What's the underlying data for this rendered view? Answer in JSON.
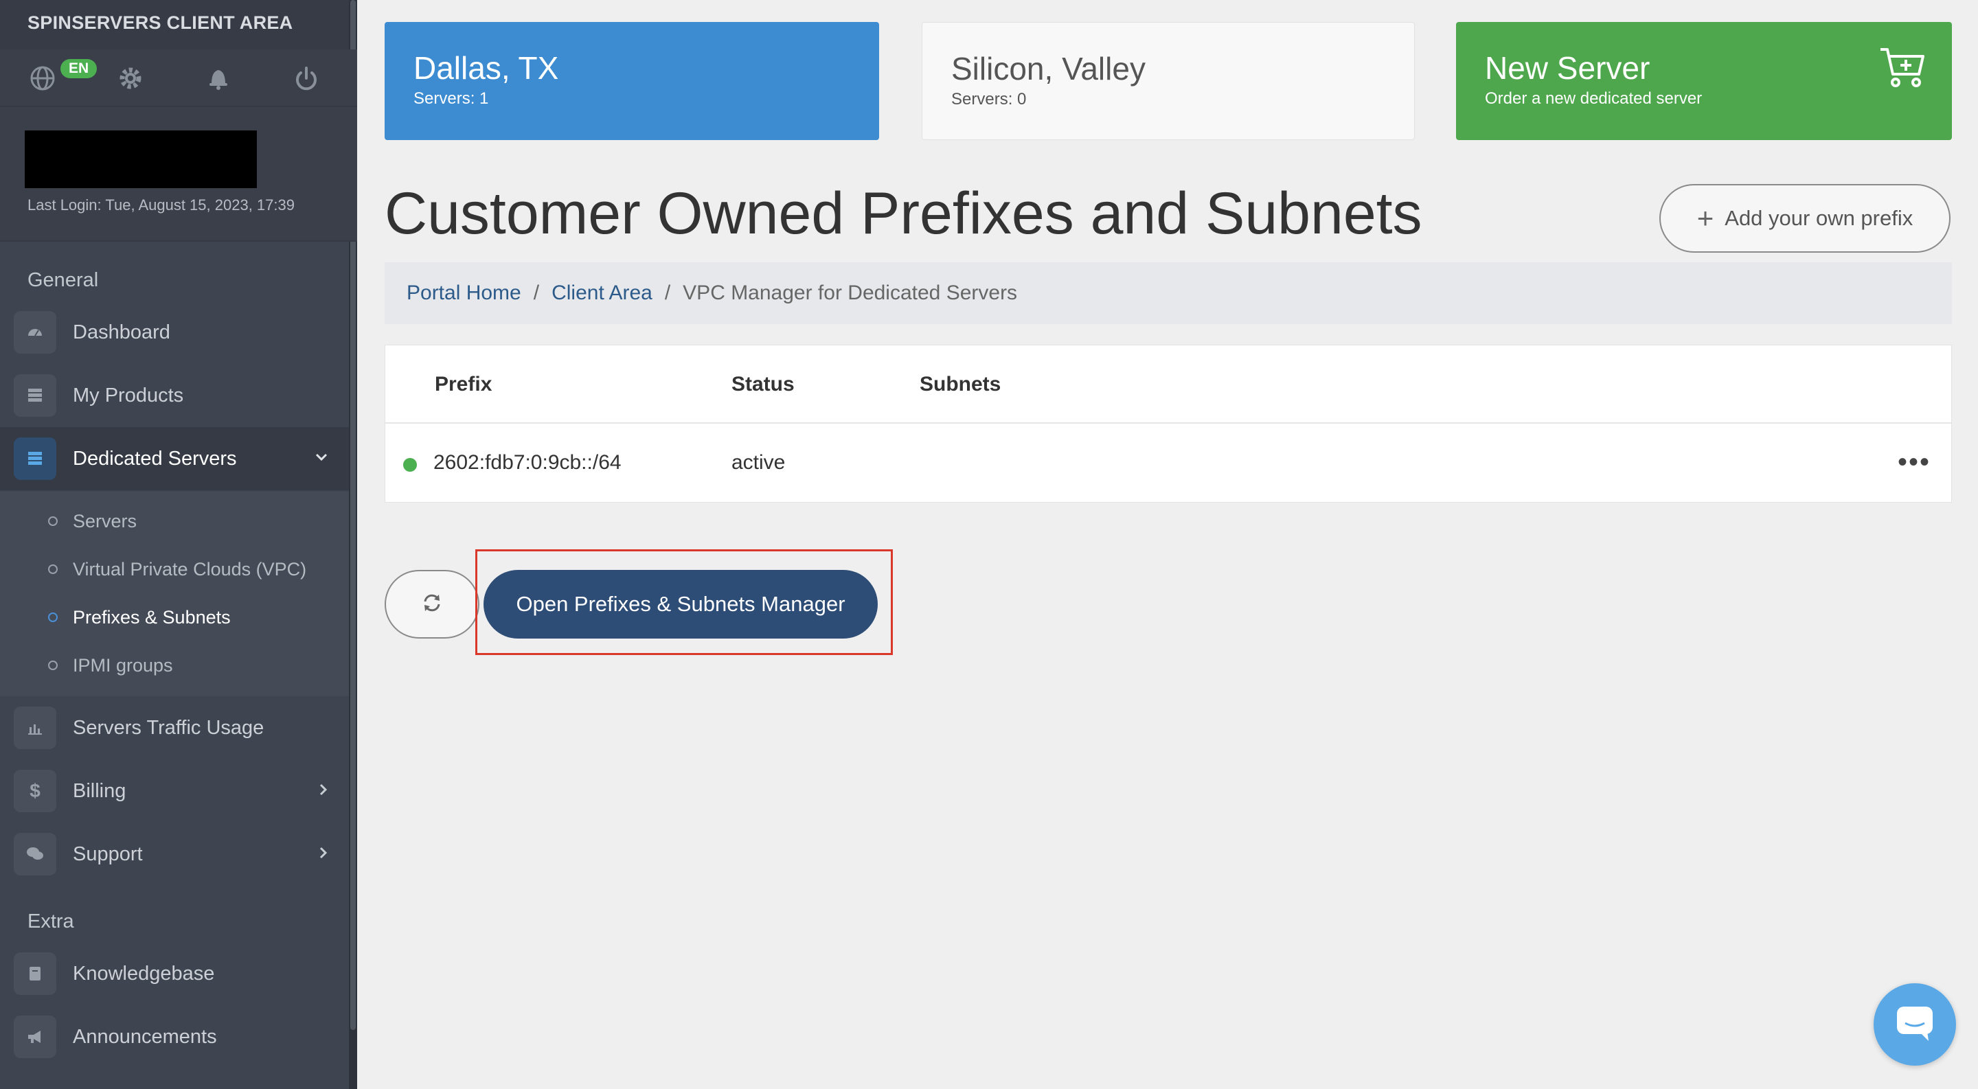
{
  "sidebar": {
    "brand": "SPINSERVERS CLIENT AREA",
    "language_badge": "EN",
    "last_login": "Last Login: Tue, August 15, 2023, 17:39",
    "section_general": "General",
    "section_extra": "Extra",
    "items": {
      "dashboard": "Dashboard",
      "my_products": "My Products",
      "dedicated_servers": "Dedicated Servers",
      "servers_traffic": "Servers Traffic Usage",
      "billing": "Billing",
      "support": "Support",
      "knowledgebase": "Knowledgebase",
      "announcements": "Announcements"
    },
    "submenu": {
      "servers": "Servers",
      "vpc": "Virtual Private Clouds (VPC)",
      "prefixes": "Prefixes & Subnets",
      "ipmi": "IPMI groups"
    }
  },
  "cards": {
    "dallas": {
      "title": "Dallas, TX",
      "sub": "Servers: 1"
    },
    "silicon": {
      "title": "Silicon, Valley",
      "sub": "Servers: 0"
    },
    "new_server": {
      "title": "New Server",
      "sub": "Order a new dedicated server"
    }
  },
  "page": {
    "title": "Customer Owned Prefixes and Subnets",
    "add_prefix": "Add your own prefix"
  },
  "breadcrumb": {
    "home": "Portal Home",
    "client_area": "Client Area",
    "current": "VPC Manager for Dedicated Servers"
  },
  "table": {
    "headers": {
      "prefix": "Prefix",
      "status": "Status",
      "subnets": "Subnets"
    },
    "rows": [
      {
        "prefix": "2602:fdb7:0:9cb::/64",
        "status": "active",
        "subnets": ""
      }
    ]
  },
  "actions": {
    "open_manager": "Open Prefixes & Subnets Manager"
  },
  "colors": {
    "accent_blue": "#3d8bd1",
    "accent_green": "#4ea74c",
    "primary_button": "#2d4d76",
    "highlight_red": "#d9382b",
    "status_active": "#4caf50"
  }
}
